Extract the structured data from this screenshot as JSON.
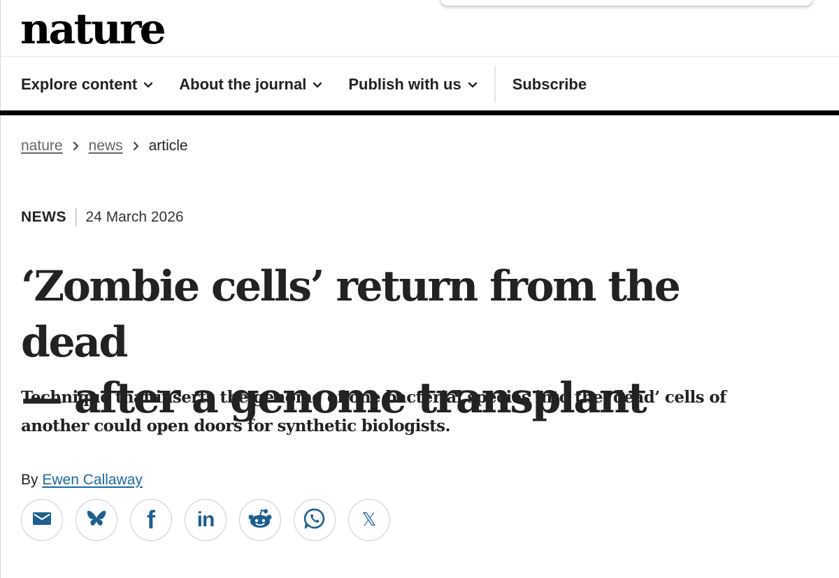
{
  "header": {
    "logo": "nature"
  },
  "nav": {
    "items": [
      {
        "label": "Explore content"
      },
      {
        "label": "About the journal"
      },
      {
        "label": "Publish with us"
      }
    ],
    "subscribe_label": "Subscribe"
  },
  "breadcrumb": {
    "items": [
      "nature",
      "news",
      "article"
    ]
  },
  "article": {
    "type": "NEWS",
    "date": "24 March 2026",
    "title_line1": "‘Zombie cells’ return from the dead",
    "title_line2": "— after a genome transplant",
    "standfirst": "Technique that inserts the genome of one bacterial species into the ‘dead’ cells of another could open doors for synthetic biologists.",
    "byline_prefix": "By",
    "author": "Ewen Callaway"
  },
  "share": {
    "icons": [
      "email-icon",
      "bluesky-icon",
      "facebook-icon",
      "linkedin-icon",
      "reddit-icon",
      "whatsapp-icon",
      "x-icon"
    ],
    "facebook_glyph": "f",
    "linkedin_glyph": "in",
    "x_glyph": "𝕏"
  },
  "colors": {
    "text": "#222222",
    "link": "#1e6a9e",
    "icon": "#1e5f8e",
    "rule": "#000000"
  }
}
